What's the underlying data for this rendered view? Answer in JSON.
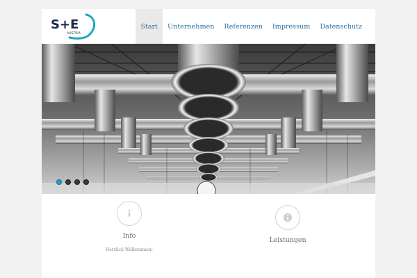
{
  "brand": {
    "logo_main": "S+E",
    "logo_sub": "AUSTRIA",
    "colors": {
      "dark": "#1c2b4a",
      "teal": "#1aa6c8"
    }
  },
  "nav": {
    "items": [
      {
        "label": "Start",
        "active": true
      },
      {
        "label": "Unternehmen"
      },
      {
        "label": "Referenzen"
      },
      {
        "label": "Impressum"
      },
      {
        "label": "Datenschutz"
      }
    ],
    "link_color": "#2d6f9b"
  },
  "hero": {
    "image": "industrial-ventilation-ducts",
    "slides": 4,
    "active_slide": 1
  },
  "features": [
    {
      "icon": "info-icon",
      "title": "Info",
      "text": "Herzlich Willkommen!"
    },
    {
      "icon": "info-icon",
      "title": "Leistungen"
    }
  ]
}
